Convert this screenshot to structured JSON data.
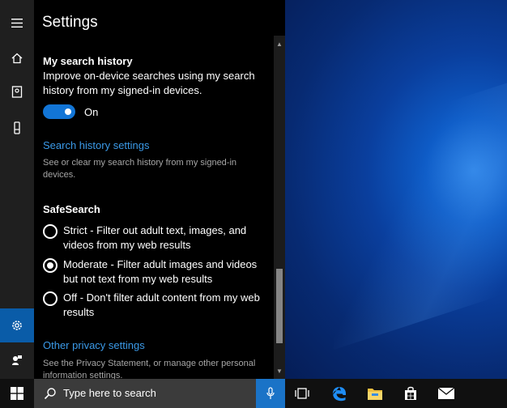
{
  "panel": {
    "title": "Settings",
    "search_history": {
      "title": "My search history",
      "description_line1": "Improve on-device searches using my search",
      "description_line2": "history from my signed-in devices.",
      "toggle_state": "On",
      "link": "Search history settings",
      "link_description_line1": "See or clear my search history from my signed-in",
      "link_description_line2": "devices."
    },
    "safesearch": {
      "title": "SafeSearch",
      "options": [
        {
          "line1": "Strict - Filter out adult text, images, and",
          "line2": "videos from my web results",
          "checked": false
        },
        {
          "line1": "Moderate - Filter adult images and videos",
          "line2": "but not text from my web results",
          "checked": true
        },
        {
          "line1": "Off - Don't filter adult content from my web",
          "line2": "results",
          "checked": false
        }
      ]
    },
    "privacy": {
      "link": "Other privacy settings",
      "description_line1": "See the Privacy Statement, or manage other personal",
      "description_line2": "information settings."
    }
  },
  "rail": {
    "items": [
      "hamburger-menu-icon",
      "home-icon",
      "notebook-icon",
      "device-icon",
      "settings-gear-icon",
      "feedback-icon"
    ],
    "active": "settings-gear-icon"
  },
  "taskbar": {
    "search_placeholder": "Type here to search",
    "icons": [
      "windows-start-icon",
      "search-icon",
      "microphone-icon",
      "task-view-icon",
      "edge-browser-icon",
      "file-explorer-icon",
      "store-icon",
      "mail-icon"
    ]
  },
  "colors": {
    "accent": "#1275d6",
    "link": "#3b9ae8",
    "active_rail": "#0a5ca8"
  }
}
